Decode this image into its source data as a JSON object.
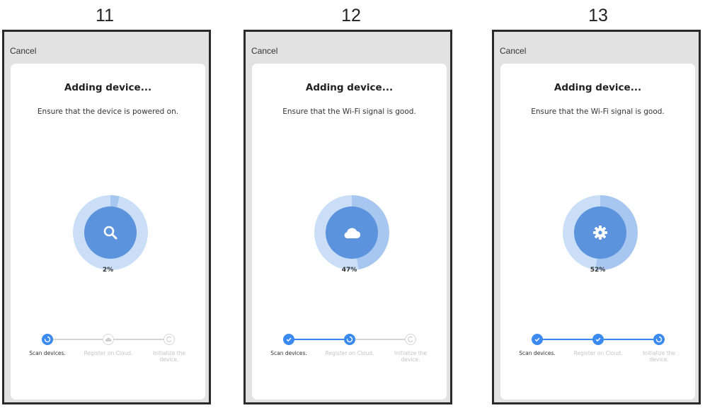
{
  "colors": {
    "accent": "#3a8af0",
    "dial_inner": "#5b93dd",
    "dial_ring": "#a8c7f0",
    "dial_track": "#cadff7",
    "pending": "#d6d6d6"
  },
  "panels": [
    {
      "number": "11",
      "cancel": "Cancel",
      "title": "Adding device...",
      "subtitle": "Ensure that the device is powered on.",
      "icon": "search-icon",
      "progress_label": "2%",
      "progress": 0.02,
      "steps": [
        {
          "label": "Scan devices.",
          "state": "active"
        },
        {
          "label": "Register on Cloud.",
          "state": "pending"
        },
        {
          "label": "Initialize the device.",
          "state": "pending"
        }
      ]
    },
    {
      "number": "12",
      "cancel": "Cancel",
      "title": "Adding device...",
      "subtitle": "Ensure that the Wi-Fi signal is good.",
      "icon": "cloud-icon",
      "progress_label": "47%",
      "progress": 0.47,
      "steps": [
        {
          "label": "Scan devices.",
          "state": "done"
        },
        {
          "label": "Register on Cloud.",
          "state": "active"
        },
        {
          "label": "Initialize the device.",
          "state": "pending"
        }
      ]
    },
    {
      "number": "13",
      "cancel": "Cancel",
      "title": "Adding device...",
      "subtitle": "Ensure that the Wi-Fi signal is good.",
      "icon": "gear-icon",
      "progress_label": "52%",
      "progress": 0.52,
      "steps": [
        {
          "label": "Scan devices.",
          "state": "done"
        },
        {
          "label": "Register on Cloud.",
          "state": "done"
        },
        {
          "label": "Initialize the device.",
          "state": "active"
        }
      ]
    }
  ]
}
